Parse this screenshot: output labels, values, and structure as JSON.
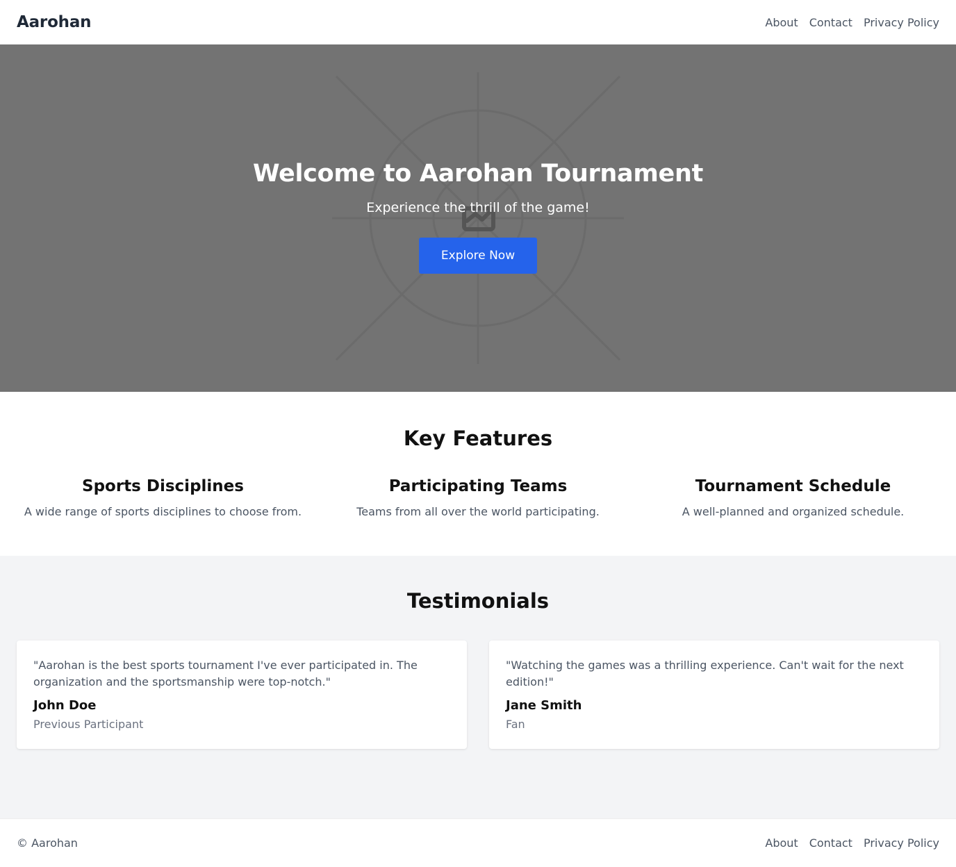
{
  "header": {
    "brand": "Aarohan",
    "nav": [
      "About",
      "Contact",
      "Privacy Policy"
    ]
  },
  "hero": {
    "title": "Welcome to Aarohan Tournament",
    "subtitle": "Experience the thrill of the game!",
    "cta_label": "Explore Now",
    "background_icon": "image-placeholder-icon"
  },
  "features": {
    "title": "Key Features",
    "items": [
      {
        "title": "Sports Disciplines",
        "description": "A wide range of sports disciplines to choose from."
      },
      {
        "title": "Participating Teams",
        "description": "Teams from all over the world participating."
      },
      {
        "title": "Tournament Schedule",
        "description": "A well-planned and organized schedule."
      }
    ]
  },
  "testimonials": {
    "title": "Testimonials",
    "items": [
      {
        "quote": "\"Aarohan is the best sports tournament I've ever participated in. The organization and the sportsmanship were top-notch.\"",
        "author": "John Doe",
        "role": "Previous Participant"
      },
      {
        "quote": "\"Watching the games was a thrilling experience. Can't wait for the next edition!\"",
        "author": "Jane Smith",
        "role": "Fan"
      }
    ]
  },
  "footer": {
    "copyright": "© Aarohan",
    "nav": [
      "About",
      "Contact",
      "Privacy Policy"
    ]
  },
  "colors": {
    "accent": "#2563eb",
    "hero_bg": "#737373",
    "testimonials_bg": "#f3f4f6"
  }
}
